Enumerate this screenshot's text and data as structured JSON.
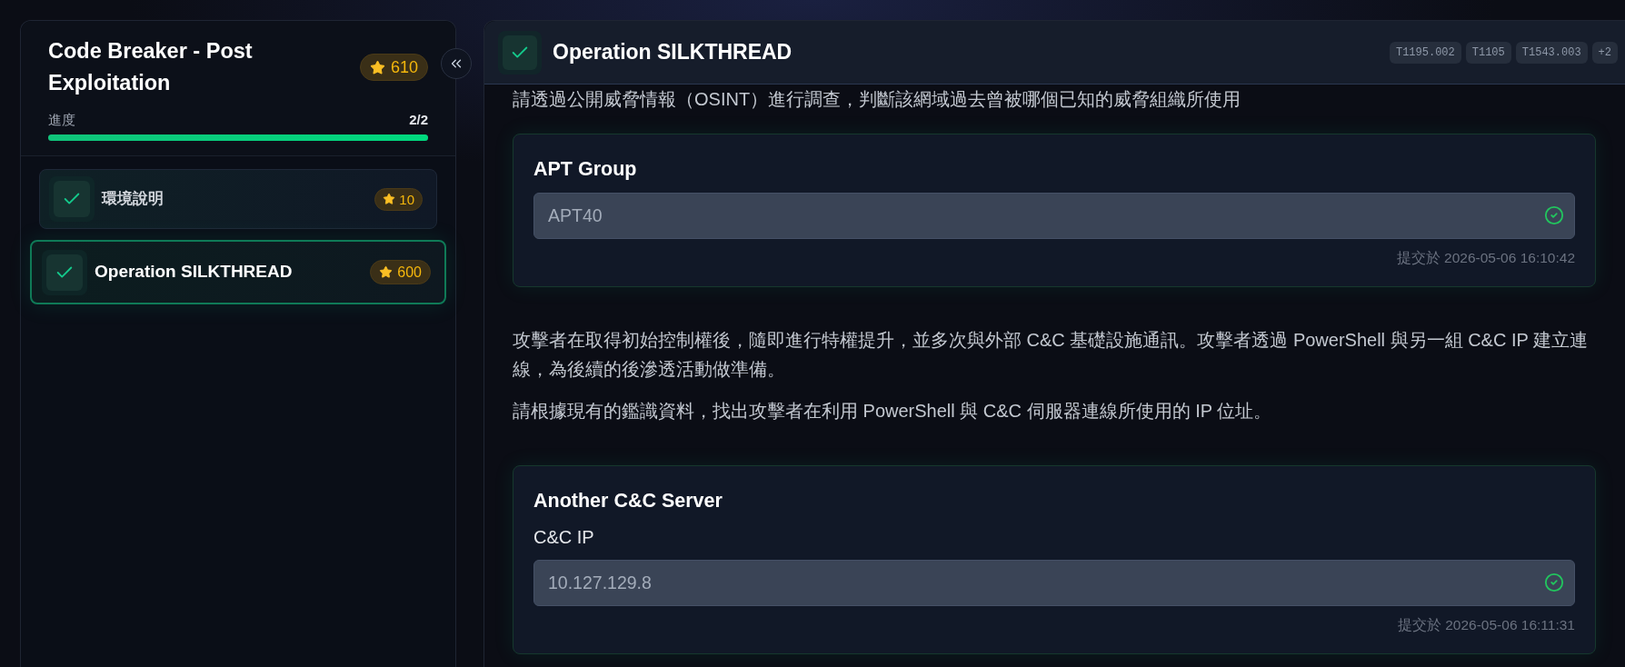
{
  "sidebar": {
    "title": "Code Breaker - Post Exploitation",
    "points": "610",
    "progress": {
      "label": "進度",
      "count": "2/2",
      "level": 1
    },
    "items": [
      {
        "title": "環境說明",
        "points": "10",
        "completed": true,
        "selected": false
      },
      {
        "title": "Operation SILKTHREAD",
        "points": "600",
        "completed": true,
        "selected": true
      }
    ]
  },
  "challenge": {
    "title": "Operation SILKTHREAD",
    "completed": true,
    "tags": [
      "T1195.002",
      "T1105",
      "T1543.003",
      "+2"
    ],
    "content": [
      {
        "kind": "paragraph",
        "text": "請透過公開威脅情報（OSINT）進行調查，判斷該網域過去曾被哪個已知的威脅組織所使用"
      },
      {
        "kind": "question",
        "title": "APT Group",
        "answer": "APT40",
        "correct": true,
        "submitted": "提交於 2026-05-06 16:10:42"
      },
      {
        "kind": "paragraph",
        "text": "攻擊者在取得初始控制權後，隨即進行特權提升，並多次與外部 C&C 基礎設施通訊。攻擊者透過 PowerShell 與另一組 C&C IP 建立連線，為後續的後滲透活動做準備。"
      },
      {
        "kind": "paragraph",
        "text": "請根據現有的鑑識資料，找出攻擊者在利用 PowerShell 與 C&C 伺服器連線所使用的 IP 位址。"
      },
      {
        "kind": "question",
        "title": "Another C&C Server",
        "field_label": "C&C IP",
        "answer": "10.127.129.8",
        "correct": true,
        "submitted": "提交於 2026-05-06 16:11:31"
      }
    ]
  }
}
